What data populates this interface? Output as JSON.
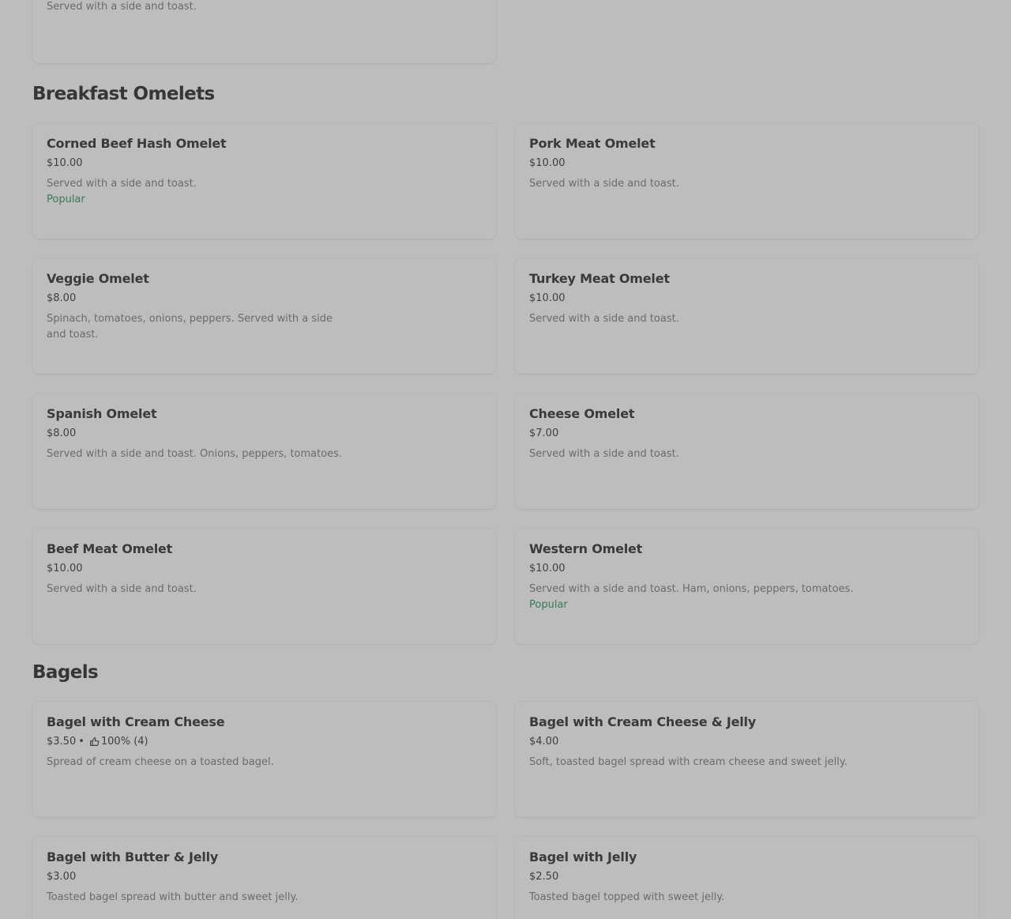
{
  "top_card": {
    "description": "Served with a side and toast."
  },
  "sections": [
    {
      "title": "Breakfast Omelets",
      "items": [
        {
          "name": "Corned Beef Hash Omelet",
          "price": "$10.00",
          "description": "Served with a side and toast.",
          "badge": "Popular"
        },
        {
          "name": "Pork Meat Omelet",
          "price": "$10.00",
          "description": "Served with a side and toast."
        },
        {
          "name": "Veggie Omelet",
          "price": "$8.00",
          "description": "Spinach, tomatoes, onions, peppers. Served with a side and toast."
        },
        {
          "name": "Turkey Meat Omelet",
          "price": "$10.00",
          "description": "Served with a side and toast."
        },
        {
          "name": "Spanish Omelet",
          "price": "$8.00",
          "description": "Served with a side and toast. Onions, peppers, tomatoes."
        },
        {
          "name": "Cheese Omelet",
          "price": "$7.00",
          "description": "Served with a side and toast."
        },
        {
          "name": "Beef Meat Omelet",
          "price": "$10.00",
          "description": "Served with a side and toast."
        },
        {
          "name": "Western Omelet",
          "price": "$10.00",
          "description": "Served with a side and toast. Ham, onions, peppers, tomatoes.",
          "badge": "Popular"
        }
      ]
    },
    {
      "title": "Bagels",
      "items": [
        {
          "name": "Bagel with Cream Cheese",
          "price": "$3.50",
          "separator": "•",
          "rating": "100% (4)",
          "rating_icon": "thumbs-up-icon",
          "description": "Spread of cream cheese on a toasted bagel."
        },
        {
          "name": "Bagel with Cream Cheese & Jelly",
          "price": "$4.00",
          "description": "Soft, toasted bagel spread with cream cheese and sweet jelly."
        },
        {
          "name": "Bagel with Butter & Jelly",
          "price": "$3.00",
          "description": "Toasted bagel spread with butter and sweet jelly."
        },
        {
          "name": "Bagel with Jelly",
          "price": "$2.50",
          "description": "Toasted bagel topped with sweet jelly."
        }
      ]
    }
  ],
  "colors": {
    "background": "#bdbdbd",
    "badge": "#3b7a57",
    "title": "#363636",
    "description": "#6b6b6b"
  }
}
